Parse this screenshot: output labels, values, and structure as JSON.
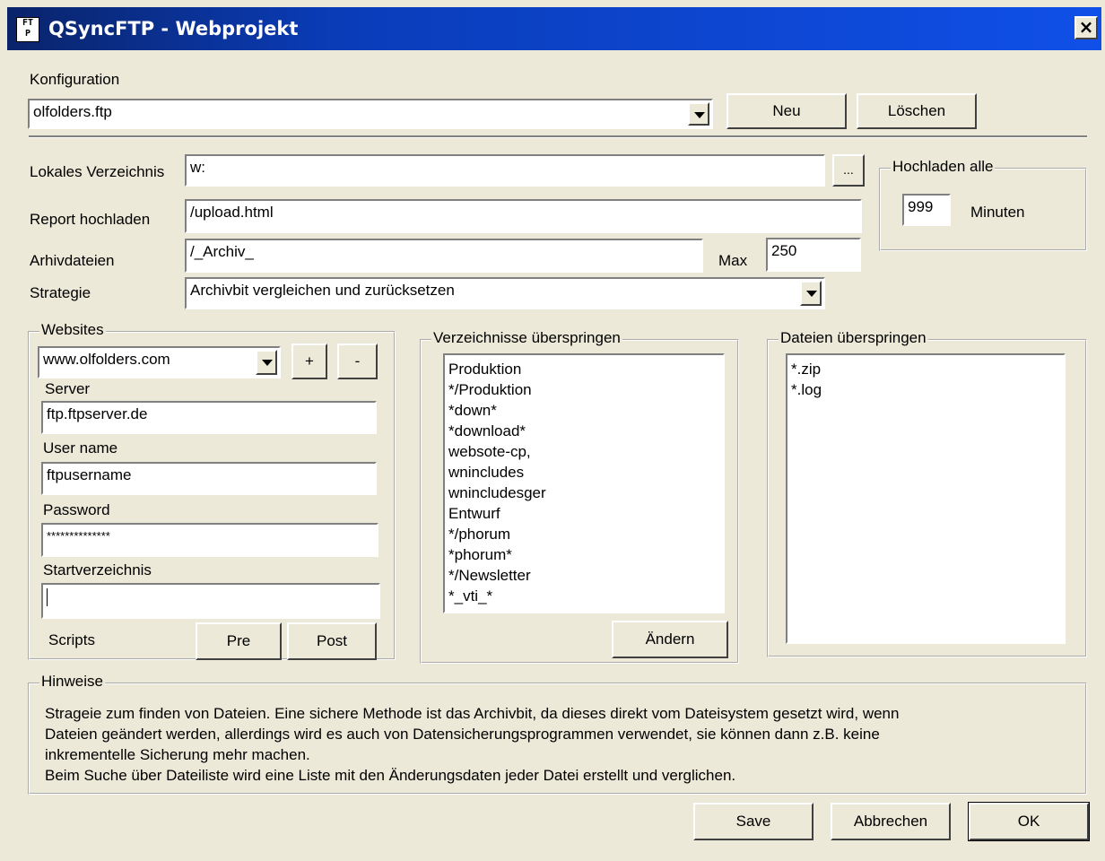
{
  "window": {
    "icon_text": "FT P",
    "title": "QSyncFTP - Webprojekt",
    "close_label": "×"
  },
  "config": {
    "label": "Konfiguration",
    "selected": "olfolders.ftp",
    "new_label": "Neu",
    "delete_label": "Löschen"
  },
  "local_dir": {
    "label": "Lokales Verzeichnis",
    "value": "w:",
    "browse_label": "..."
  },
  "upload_interval": {
    "group_label": "Hochladen alle",
    "value": "999",
    "unit": "Minuten"
  },
  "report": {
    "label": "Report hochladen",
    "value": "/upload.html"
  },
  "archive": {
    "label": "Arhivdateien",
    "value": "/_Archiv_",
    "max_label": "Max",
    "max_value": "250"
  },
  "strategy": {
    "label": "Strategie",
    "selected": "Archivbit vergleichen und zurücksetzen"
  },
  "websites": {
    "group_label": "Websites",
    "selected": "www.olfolders.com",
    "add_label": "+",
    "remove_label": "-",
    "server_label": "Server",
    "server_value": "ftp.ftpserver.de",
    "username_label": "User name",
    "username_value": "ftpusername",
    "password_label": "Password",
    "password_value": "**************",
    "startdir_label": "Startverzeichnis",
    "startdir_value": "",
    "scripts_label": "Scripts",
    "pre_label": "Pre",
    "post_label": "Post"
  },
  "skip_dirs": {
    "group_label": "Verzeichnisse überspringen",
    "items": [
      "Produktion",
      "*/Produktion",
      "*down*",
      "*download*",
      "websote-cp,",
      "wnincludes",
      "wnincludesger",
      "Entwurf",
      "*/phorum",
      "*phorum*",
      "*/Newsletter",
      "*_vti_*"
    ],
    "change_label": "Ändern"
  },
  "skip_files": {
    "group_label": "Dateien überspringen",
    "items": [
      "*.zip",
      "*.log"
    ]
  },
  "hints": {
    "group_label": "Hinweise",
    "lines": [
      "Strageie zum finden von Dateien. Eine sichere Methode ist das Archivbit, da dieses direkt vom Dateisystem gesetzt wird, wenn",
      "Dateien geändert werden, allerdings wird es auch von Datensicherungsprogrammen verwendet, sie können dann z.B. keine",
      "inkrementelle Sicherung mehr machen.",
      "Beim Suche über Dateiliste wird eine Liste mit den Änderungsdaten jeder Datei erstellt und verglichen."
    ]
  },
  "footer": {
    "save_label": "Save",
    "cancel_label": "Abbrechen",
    "ok_label": "OK"
  }
}
